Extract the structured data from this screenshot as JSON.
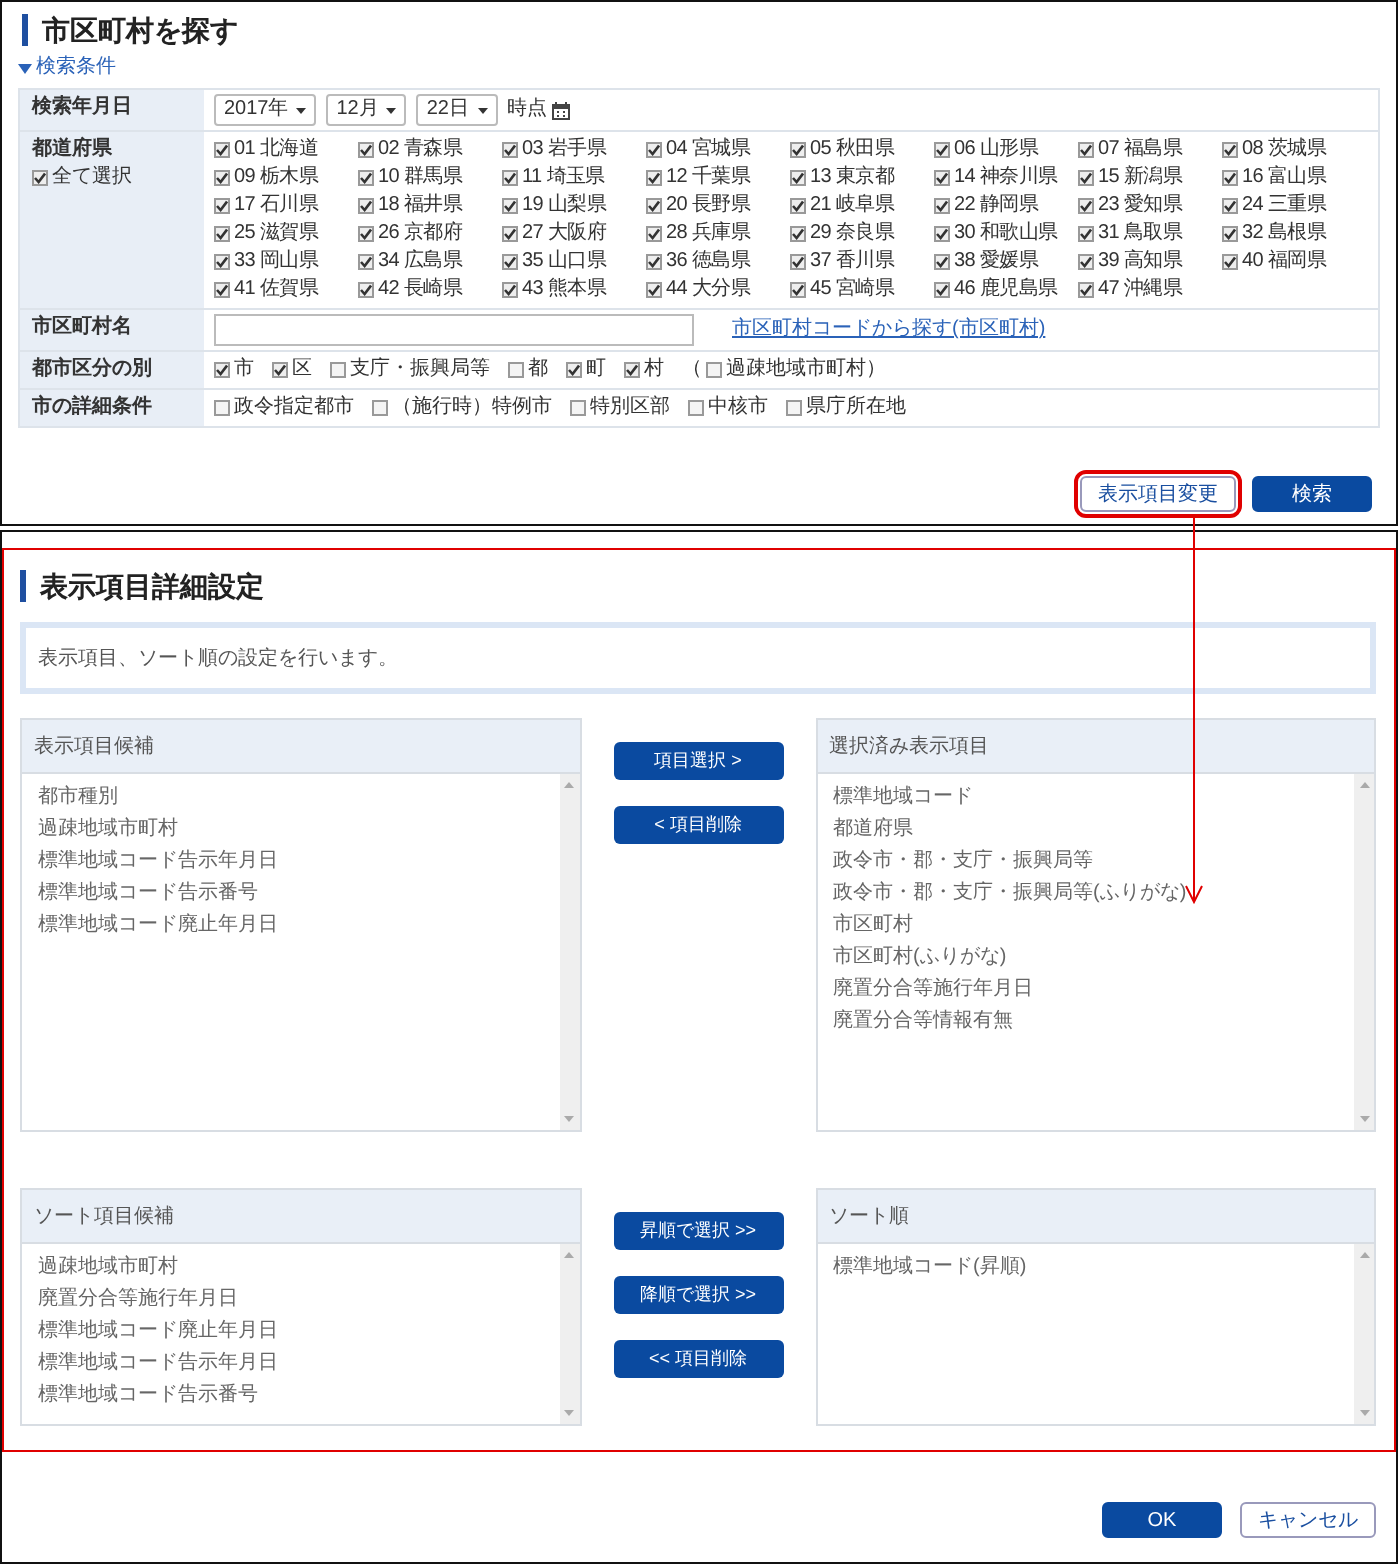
{
  "search_panel": {
    "title": "市区町村を探す",
    "toggle": {
      "label": "検索条件",
      "expanded": true
    },
    "date_row": {
      "label": "検索年月日",
      "selects": [
        "2017年",
        "12月",
        "22日"
      ],
      "suffix": "時点"
    },
    "prefecture_row": {
      "label": "都道府県",
      "select_all": {
        "label": "全て選択",
        "checked": true
      },
      "prefectures": [
        {
          "label": "01 北海道",
          "checked": true
        },
        {
          "label": "02 青森県",
          "checked": true
        },
        {
          "label": "03 岩手県",
          "checked": true
        },
        {
          "label": "04 宮城県",
          "checked": true
        },
        {
          "label": "05 秋田県",
          "checked": true
        },
        {
          "label": "06 山形県",
          "checked": true
        },
        {
          "label": "07 福島県",
          "checked": true
        },
        {
          "label": "08 茨城県",
          "checked": true
        },
        {
          "label": "09 栃木県",
          "checked": true
        },
        {
          "label": "10 群馬県",
          "checked": true
        },
        {
          "label": "11 埼玉県",
          "checked": true
        },
        {
          "label": "12 千葉県",
          "checked": true
        },
        {
          "label": "13 東京都",
          "checked": true
        },
        {
          "label": "14 神奈川県",
          "checked": true
        },
        {
          "label": "15 新潟県",
          "checked": true
        },
        {
          "label": "16 富山県",
          "checked": true
        },
        {
          "label": "17 石川県",
          "checked": true
        },
        {
          "label": "18 福井県",
          "checked": true
        },
        {
          "label": "19 山梨県",
          "checked": true
        },
        {
          "label": "20 長野県",
          "checked": true
        },
        {
          "label": "21 岐阜県",
          "checked": true
        },
        {
          "label": "22 静岡県",
          "checked": true
        },
        {
          "label": "23 愛知県",
          "checked": true
        },
        {
          "label": "24 三重県",
          "checked": true
        },
        {
          "label": "25 滋賀県",
          "checked": true
        },
        {
          "label": "26 京都府",
          "checked": true
        },
        {
          "label": "27 大阪府",
          "checked": true
        },
        {
          "label": "28 兵庫県",
          "checked": true
        },
        {
          "label": "29 奈良県",
          "checked": true
        },
        {
          "label": "30 和歌山県",
          "checked": true
        },
        {
          "label": "31 鳥取県",
          "checked": true
        },
        {
          "label": "32 島根県",
          "checked": true
        },
        {
          "label": "33 岡山県",
          "checked": true
        },
        {
          "label": "34 広島県",
          "checked": true
        },
        {
          "label": "35 山口県",
          "checked": true
        },
        {
          "label": "36 徳島県",
          "checked": true
        },
        {
          "label": "37 香川県",
          "checked": true
        },
        {
          "label": "38 愛媛県",
          "checked": true
        },
        {
          "label": "39 高知県",
          "checked": true
        },
        {
          "label": "40 福岡県",
          "checked": true
        },
        {
          "label": "41 佐賀県",
          "checked": true
        },
        {
          "label": "42 長崎県",
          "checked": true
        },
        {
          "label": "43 熊本県",
          "checked": true
        },
        {
          "label": "44 大分県",
          "checked": true
        },
        {
          "label": "45 宮崎県",
          "checked": true
        },
        {
          "label": "46 鹿児島県",
          "checked": true
        },
        {
          "label": "47 沖縄県",
          "checked": true
        }
      ]
    },
    "city_row": {
      "label": "市区町村名",
      "link": "市区町村コードから探す(市区町村)"
    },
    "option_rows": [
      {
        "label": "都市区分の別",
        "options": [
          {
            "label": "市",
            "checked": true
          },
          {
            "label": "区",
            "checked": true
          },
          {
            "label": "支庁・振興局等",
            "checked": false
          },
          {
            "label": "都",
            "checked": false
          },
          {
            "label": "町",
            "checked": true
          },
          {
            "label": "村",
            "checked": true
          },
          {
            "prefix": "（",
            "label": "過疎地域市町村）",
            "checked": false
          }
        ]
      },
      {
        "label": "市の詳細条件",
        "options": [
          {
            "label": "政令指定都市",
            "checked": false
          },
          {
            "label": "（施行時）特例市",
            "checked": false
          },
          {
            "label": "特別区部",
            "checked": false
          },
          {
            "label": "中核市",
            "checked": false
          },
          {
            "label": "県庁所在地",
            "checked": false
          }
        ]
      }
    ],
    "buttons": [
      {
        "label": "表示項目変更",
        "kind": "secondary",
        "highlighted": true
      },
      {
        "label": "検索",
        "kind": "primary",
        "highlighted": false
      }
    ]
  },
  "dialog": {
    "title": "表示項目詳細設定",
    "highlighted": true,
    "description": "表示項目、ソート順の設定を行います。",
    "display_candidates": {
      "header": "表示項目候補",
      "items": [
        "都市種別",
        "過疎地域市町村",
        "標準地域コード告示年月日",
        "標準地域コード告示番号",
        "標準地域コード廃止年月日"
      ]
    },
    "display_buttons": [
      "項目選択 >",
      "< 項目削除"
    ],
    "selected_display": {
      "header": "選択済み表示項目",
      "items": [
        "標準地域コード",
        "都道府県",
        "政令市・郡・支庁・振興局等",
        "政令市・郡・支庁・振興局等(ふりがな)",
        "市区町村",
        "市区町村(ふりがな)",
        "廃置分合等施行年月日",
        "廃置分合等情報有無"
      ]
    },
    "sort_candidates": {
      "header": "ソート項目候補",
      "items": [
        "過疎地域市町村",
        "廃置分合等施行年月日",
        "標準地域コード廃止年月日",
        "標準地域コード告示年月日",
        "標準地域コード告示番号"
      ]
    },
    "sort_buttons": [
      "昇順で選択 >>",
      "降順で選択 >>",
      "<< 項目削除"
    ],
    "sort_order": {
      "header": "ソート順",
      "items": [
        "標準地域コード(昇順)"
      ]
    },
    "footer_buttons": [
      {
        "label": "OK",
        "kind": "primary"
      },
      {
        "label": "キャンセル",
        "kind": "secondary"
      }
    ]
  }
}
